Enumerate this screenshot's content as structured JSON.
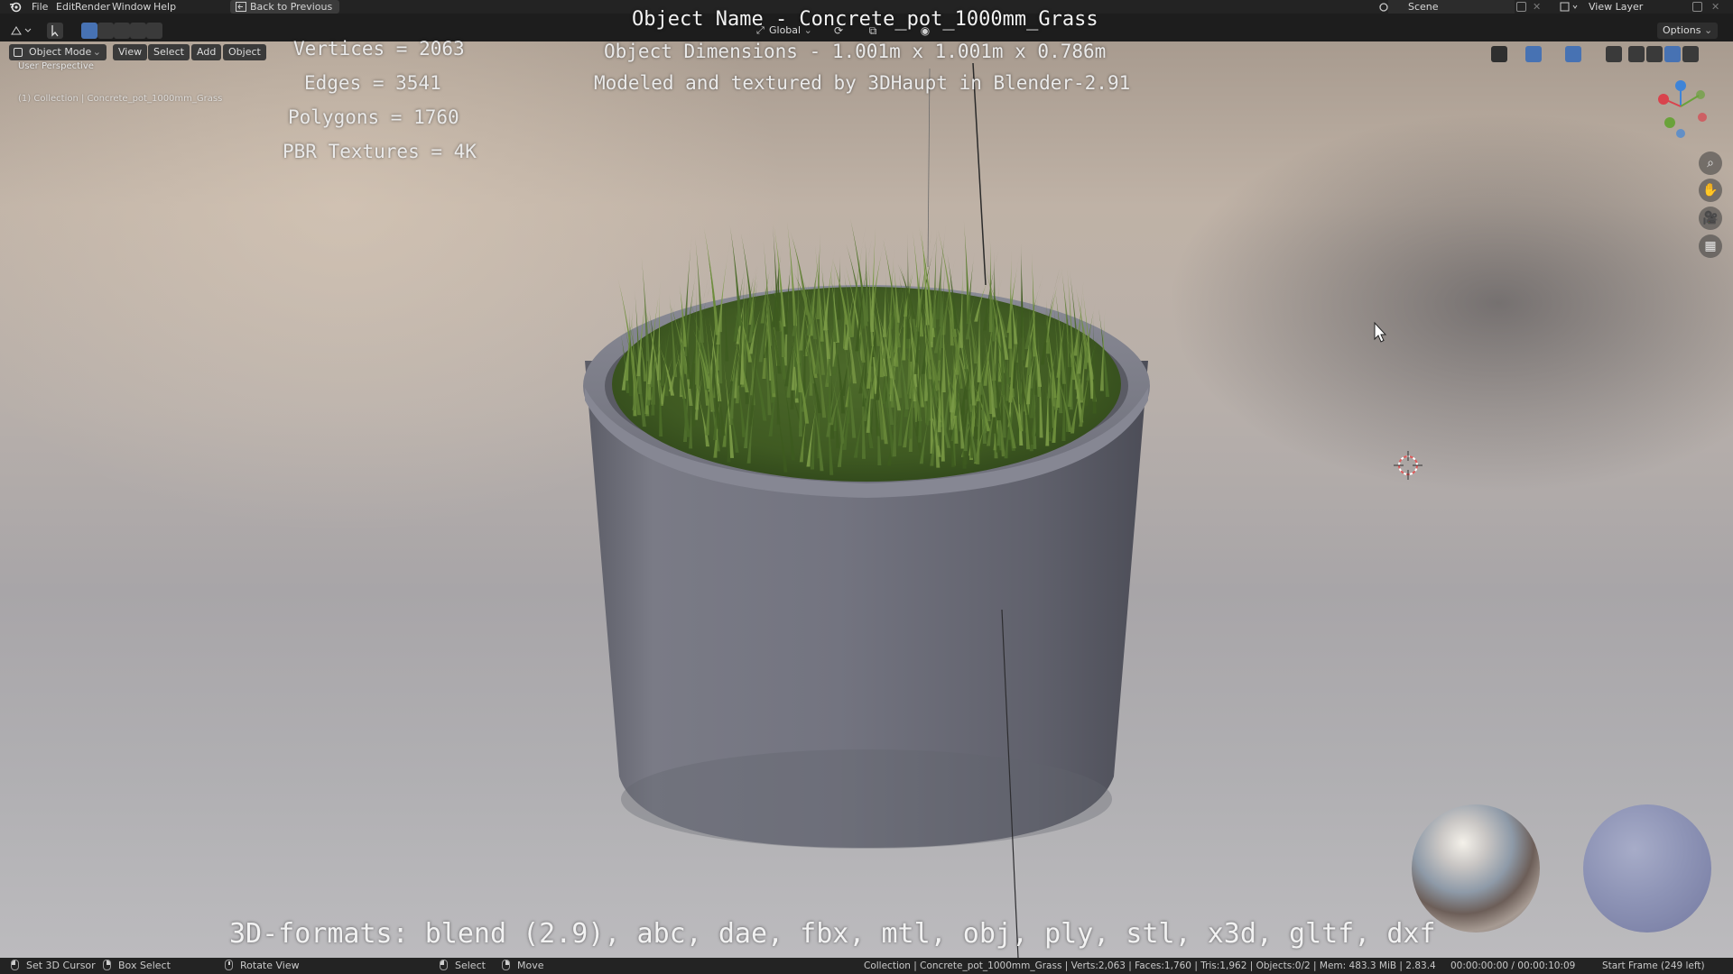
{
  "menu": {
    "file": "File",
    "edit": "Edit",
    "render": "Render",
    "window": "Window",
    "help": "Help",
    "back_to_previous": "Back to Previous"
  },
  "topbar_right": {
    "scene": "Scene",
    "view_layer": "View Layer",
    "options": "Options"
  },
  "header": {
    "mode": "Object Mode",
    "view": "View",
    "select": "Select",
    "add": "Add",
    "object": "Object",
    "transform_orientation": "Global"
  },
  "viewport_info": {
    "perspective": "User Perspective",
    "collection": "(1) Collection | Concrete_pot_1000mm_Grass"
  },
  "overlay": {
    "object_name": "Object Name - Concrete_pot_1000mm_Grass",
    "vertices": "Vertices = 2063",
    "edges": "Edges = 3541",
    "polygons": "Polygons = 1760",
    "pbr_textures": "PBR Textures = 4K",
    "dimensions": "Object Dimensions -  1.001m x 1.001m x 0.786m",
    "modeled_by": "Modeled and textured by 3DHaupt in Blender-2.91",
    "formats": "3D-formats: blend (2.9), abc, dae, fbx, mtl, obj, ply, stl, x3d, gltf, dxf"
  },
  "statusbar": {
    "set_cursor": "Set 3D Cursor",
    "box_select": "Box Select",
    "rotate_view": "Rotate View",
    "select": "Select",
    "move": "Move",
    "stats": "Collection | Concrete_pot_1000mm_Grass | Verts:2,063 | Faces:1,760 | Tris:1,962 | Objects:0/2 | Mem: 483.3 MiB | 2.83.4",
    "time": "00:00:00:00 / 00:00:10:09",
    "start_frame": "Start Frame (249 left)"
  },
  "icons": {
    "blender_logo": "blender-logo-icon",
    "zoom": "zoom-icon",
    "pan": "hand-pan-icon",
    "camera": "camera-icon",
    "grid": "grid-icon",
    "cursor": "3d-cursor-icon",
    "mouse_pointer": "mouse-pointer-icon"
  },
  "colors": {
    "accent": "#4772b3",
    "axis_x": "#d9434d",
    "axis_y": "#6aa23a",
    "axis_z": "#3e84d8"
  }
}
